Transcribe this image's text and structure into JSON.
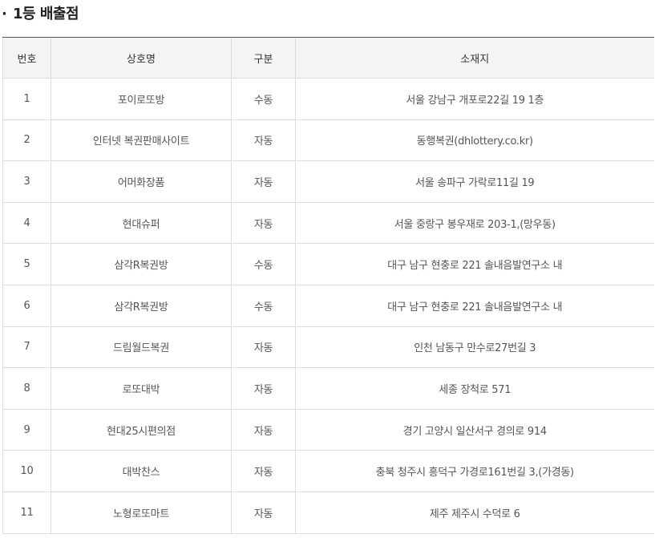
{
  "section": {
    "bullet": "·",
    "title": "1등 배출점"
  },
  "table": {
    "headers": {
      "no": "번호",
      "name": "상호명",
      "type": "구분",
      "address": "소재지"
    },
    "rows": [
      {
        "no": "1",
        "name": "포이로또방",
        "type": "수동",
        "address": "서울 강남구 개포로22길 19 1층"
      },
      {
        "no": "2",
        "name": "인터넷 복권판매사이트",
        "type": "자동",
        "address": "동행복권(dhlottery.co.kr)"
      },
      {
        "no": "3",
        "name": "어머화장품",
        "type": "자동",
        "address": "서울 송파구 가락로11길 19"
      },
      {
        "no": "4",
        "name": "현대슈퍼",
        "type": "자동",
        "address": "서울 중랑구 봉우재로 203-1,(망우동)"
      },
      {
        "no": "5",
        "name": "삼각R복권방",
        "type": "수동",
        "address": "대구 남구 현충로 221 솔내음발연구소 내"
      },
      {
        "no": "6",
        "name": "삼각R복권방",
        "type": "수동",
        "address": "대구 남구 현충로 221 솔내음발연구소 내"
      },
      {
        "no": "7",
        "name": "드림월드복권",
        "type": "자동",
        "address": "인천 남동구 만수로27번길 3"
      },
      {
        "no": "8",
        "name": "로또대박",
        "type": "자동",
        "address": "세종 장척로 571"
      },
      {
        "no": "9",
        "name": "현대25시편의점",
        "type": "자동",
        "address": "경기 고양시 일산서구 경의로 914"
      },
      {
        "no": "10",
        "name": "대박찬스",
        "type": "자동",
        "address": "충북 청주시 흥덕구 가경로161번길 3,(가경동)"
      },
      {
        "no": "11",
        "name": "노형로또마트",
        "type": "자동",
        "address": "제주 제주시 수덕로 6"
      }
    ]
  }
}
